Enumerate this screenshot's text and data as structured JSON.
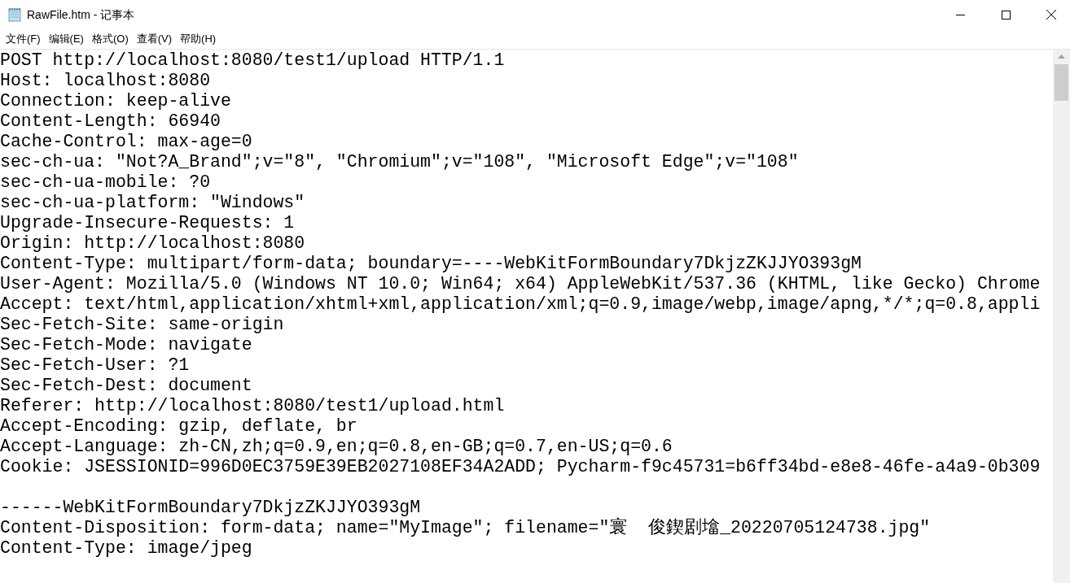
{
  "window": {
    "title": "RawFile.htm - 记事本"
  },
  "menu": [
    "文件(F)",
    "编辑(E)",
    "格式(O)",
    "查看(V)",
    "帮助(H)"
  ],
  "editor": {
    "lines": [
      "POST http://localhost:8080/test1/upload HTTP/1.1",
      "Host: localhost:8080",
      "Connection: keep-alive",
      "Content-Length: 66940",
      "Cache-Control: max-age=0",
      "sec-ch-ua: \"Not?A_Brand\";v=\"8\", \"Chromium\";v=\"108\", \"Microsoft Edge\";v=\"108\"",
      "sec-ch-ua-mobile: ?0",
      "sec-ch-ua-platform: \"Windows\"",
      "Upgrade-Insecure-Requests: 1",
      "Origin: http://localhost:8080",
      "Content-Type: multipart/form-data; boundary=----WebKitFormBoundary7DkjzZKJJYO393gM",
      "User-Agent: Mozilla/5.0 (Windows NT 10.0; Win64; x64) AppleWebKit/537.36 (KHTML, like Gecko) Chrome",
      "Accept: text/html,application/xhtml+xml,application/xml;q=0.9,image/webp,image/apng,*/*;q=0.8,appli",
      "Sec-Fetch-Site: same-origin",
      "Sec-Fetch-Mode: navigate",
      "Sec-Fetch-User: ?1",
      "Sec-Fetch-Dest: document",
      "Referer: http://localhost:8080/test1/upload.html",
      "Accept-Encoding: gzip, deflate, br",
      "Accept-Language: zh-CN,zh;q=0.9,en;q=0.8,en-GB;q=0.7,en-US;q=0.6",
      "Cookie: JSESSIONID=996D0EC3759E39EB2027108EF34A2ADD; Pycharm-f9c45731=b6ff34bd-e8e8-46fe-a4a9-0b309"
    ],
    "body_lines": [
      "------WebKitFormBoundary7DkjzZKJJYO393gM",
      "Content-Disposition: form-data; name=\"MyImage\"; filename=\"寰  俊鍥剧墖_20220705124738.jpg\"",
      "Content-Type: image/jpeg"
    ]
  }
}
